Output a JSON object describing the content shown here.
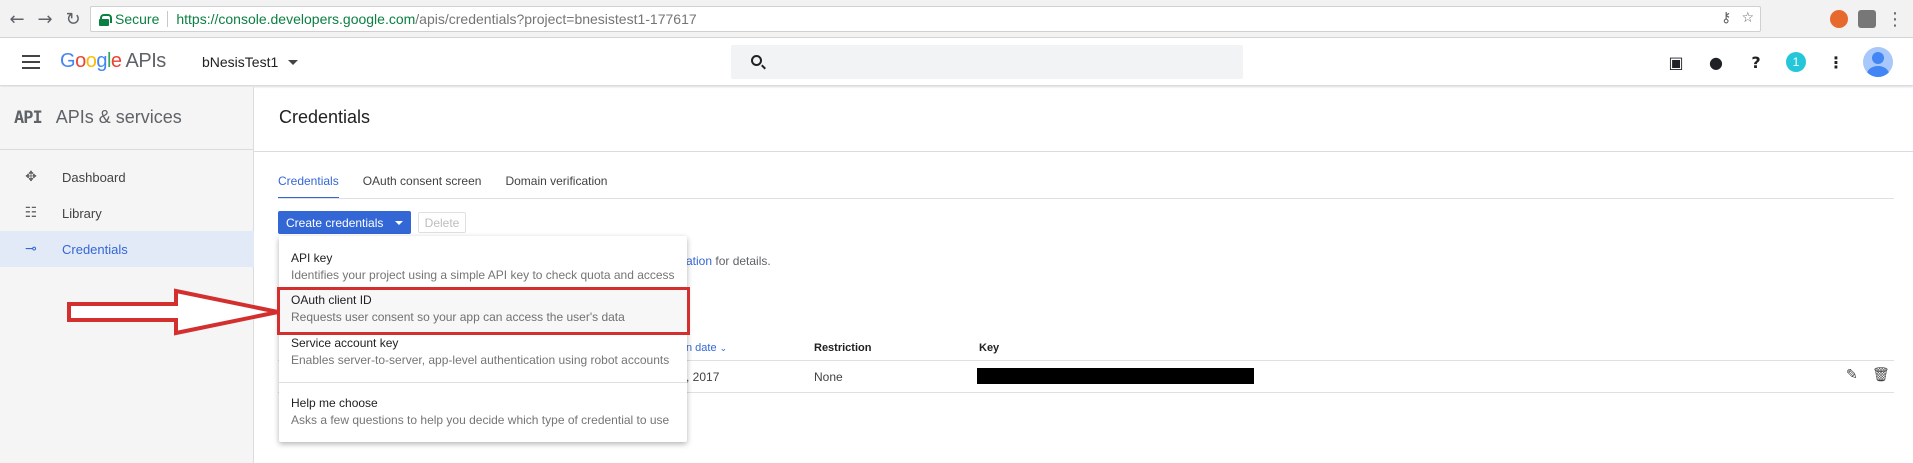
{
  "browser": {
    "secure_label": "Secure",
    "url_host": "https://console.developers.google.com",
    "url_path": "/apis/credentials?project=bnesistest1-177617"
  },
  "header": {
    "logo_google": "Google",
    "logo_apis": "APIs",
    "project_name": "bNesisTest1",
    "notification_count": "1"
  },
  "sidebar": {
    "title_mark": "API",
    "title": "APIs & services",
    "items": [
      {
        "label": "Dashboard",
        "icon": "dashboard-icon"
      },
      {
        "label": "Library",
        "icon": "library-icon"
      },
      {
        "label": "Credentials",
        "icon": "key-icon"
      }
    ]
  },
  "main": {
    "title": "Credentials",
    "tabs": [
      "Credentials",
      "OAuth consent screen",
      "Domain verification"
    ],
    "create_button": "Create credentials",
    "delete_button": "Delete",
    "info_link": "ation",
    "info_suffix": " for details.",
    "table": {
      "headers": {
        "date": "n date",
        "restriction": "Restriction",
        "key": "Key"
      },
      "row": {
        "date": ", 2017",
        "restriction": "None"
      }
    }
  },
  "menu": {
    "items": [
      {
        "title": "API key",
        "desc": "Identifies your project using a simple API key to check quota and access"
      },
      {
        "title": "OAuth client ID",
        "desc": "Requests user consent so your app can access the user's data"
      },
      {
        "title": "Service account key",
        "desc": "Enables server-to-server, app-level authentication using robot accounts"
      },
      {
        "title": "Help me choose",
        "desc": "Asks a few questions to help you decide which type of credential to use"
      }
    ]
  },
  "colors": {
    "accent": "#3367d6",
    "highlight": "#d32f2f",
    "secure": "#0b8043"
  }
}
